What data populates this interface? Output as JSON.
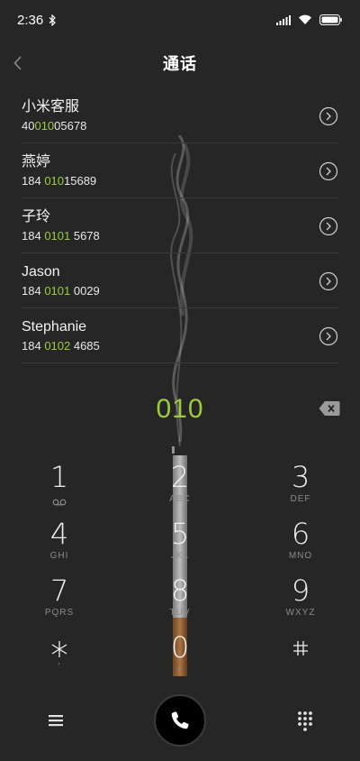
{
  "status_bar": {
    "time": "2:36",
    "icons": [
      "bluetooth-icon",
      "signal-icon",
      "wifi-icon",
      "battery-icon"
    ]
  },
  "header": {
    "title": "通话"
  },
  "contacts": [
    {
      "name": "小米客服",
      "number_pre": "40",
      "number_match": "010",
      "number_post": "05678"
    },
    {
      "name": "燕婷",
      "number_pre": "184 ",
      "number_match": "010",
      "number_post": "15689"
    },
    {
      "name": "子玲",
      "number_pre": "184 ",
      "number_match": "0101",
      "number_post": " 5678"
    },
    {
      "name": "Jason",
      "number_pre": "184 ",
      "number_match": "0101",
      "number_post": " 0029"
    },
    {
      "name": "Stephanie",
      "number_pre": "184 ",
      "number_match": "0102",
      "number_post": " 4685"
    }
  ],
  "dialed_number": "010",
  "keypad": [
    {
      "digit": "1",
      "letters": "voicemail-icon"
    },
    {
      "digit": "2",
      "letters": "ABC"
    },
    {
      "digit": "3",
      "letters": "DEF"
    },
    {
      "digit": "4",
      "letters": "GHI"
    },
    {
      "digit": "5",
      "letters": "JKL"
    },
    {
      "digit": "6",
      "letters": "MNO"
    },
    {
      "digit": "7",
      "letters": "PQRS"
    },
    {
      "digit": "8",
      "letters": "TUV"
    },
    {
      "digit": "9",
      "letters": "WXYZ"
    },
    {
      "digit": "*",
      "letters": "'"
    },
    {
      "digit": "0",
      "letters": "+"
    },
    {
      "digit": "#",
      "letters": ""
    }
  ],
  "colors": {
    "background": "#262626",
    "accent": "#9ccc3c",
    "divider": "#3a3a3a"
  }
}
